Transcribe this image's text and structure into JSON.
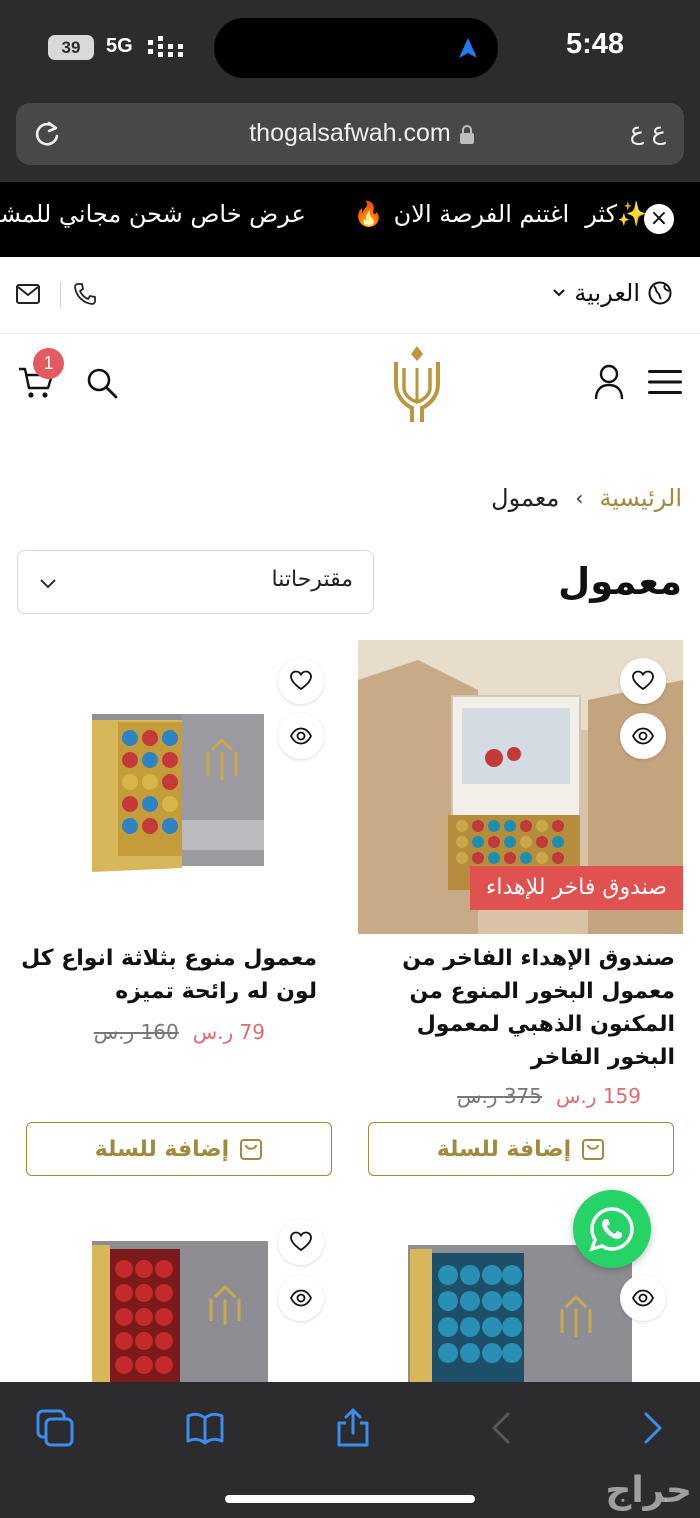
{
  "status_bar": {
    "battery": "39",
    "network": "5G",
    "time": "5:48"
  },
  "browser": {
    "url": "thogalsafwah.com",
    "reader_label": "ع ع"
  },
  "announcement": {
    "segments": [
      "اغتنم الفرصة الان",
      "عرض خاص شحن مجاني للمشتريات",
      "كثر"
    ],
    "emoji_fire": "🔥",
    "emoji_sparkle": "✨",
    "close": "×"
  },
  "topbar": {
    "language": "العربية"
  },
  "header": {
    "cart_count": "1"
  },
  "breadcrumb": {
    "home": "الرئيسية",
    "separator": "›",
    "current": "معمول"
  },
  "page": {
    "title": "معمول"
  },
  "sort": {
    "label": "مقترحاتنا"
  },
  "products": [
    {
      "name": "صندوق الإهداء الفاخر من معمول البخور المنوع من المكنون الذهبي لمعمول البخور الفاخر",
      "badge": "صندوق فاخر للإهداء",
      "price_now": "159 ر.س",
      "price_old": "375 ر.س",
      "button": "إضافة للسلة"
    },
    {
      "name": "معمول منوع بثلاثة انواع كل لون له رائحة تميزه",
      "price_now": "79 ر.س",
      "price_old": "160 ر.س",
      "button": "إضافة للسلة"
    }
  ],
  "watermark": "حراج"
}
